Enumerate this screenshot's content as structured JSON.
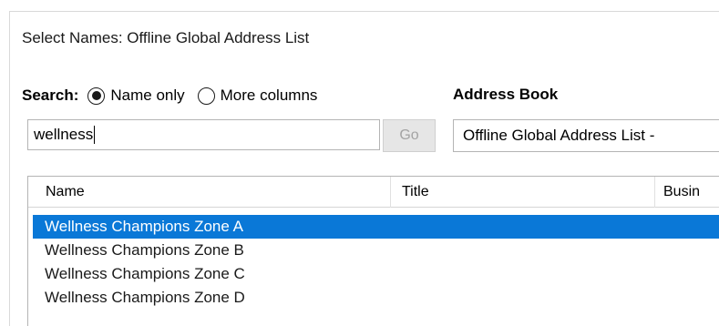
{
  "window": {
    "title": "Select Names: Offline Global Address List"
  },
  "search": {
    "label": "Search:",
    "options": [
      {
        "label": "Name only",
        "selected": true
      },
      {
        "label": "More columns",
        "selected": false
      }
    ],
    "input_value": "wellness",
    "go_label": "Go"
  },
  "address_book": {
    "label": "Address Book",
    "selected_value": "Offline Global Address List -"
  },
  "list": {
    "columns": [
      "Name",
      "Title",
      "Busin"
    ],
    "rows": [
      {
        "name": "Wellness Champions Zone A",
        "selected": true
      },
      {
        "name": "Wellness Champions Zone B",
        "selected": false
      },
      {
        "name": "Wellness Champions Zone C",
        "selected": false
      },
      {
        "name": "Wellness Champions Zone D",
        "selected": false
      }
    ]
  },
  "colors": {
    "selection": "#0a78d7",
    "accent": "#6aa0dc",
    "disabled_text": "#a3a3a3"
  }
}
